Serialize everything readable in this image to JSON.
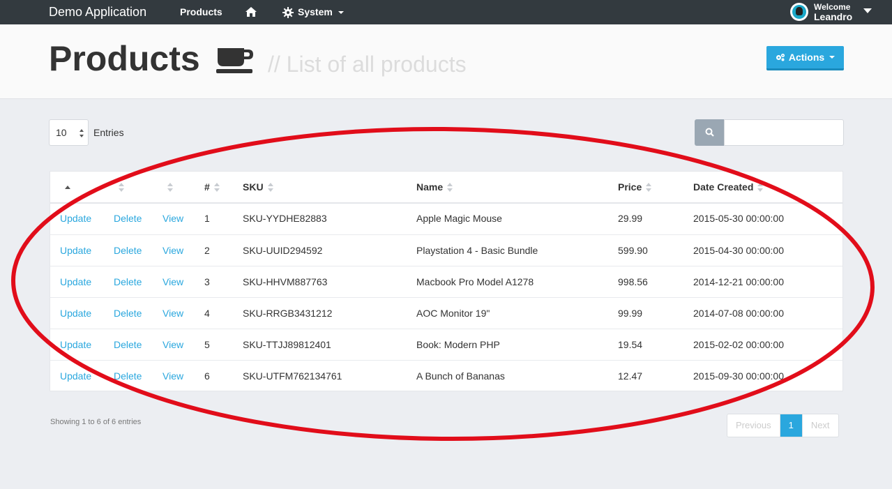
{
  "navbar": {
    "brand": "Demo Application",
    "products": "Products",
    "system": "System",
    "welcome": "Welcome",
    "username": "Leandro"
  },
  "header": {
    "title": "Products",
    "subtitle": "// List of all products",
    "actions_label": "Actions"
  },
  "toolbar": {
    "entries_value": "10",
    "entries_label": "Entries"
  },
  "table": {
    "columns": [
      "#",
      "SKU",
      "Name",
      "Price",
      "Date Created"
    ],
    "row_actions": [
      "Update",
      "Delete",
      "View"
    ],
    "rows": [
      {
        "id": "1",
        "sku": "SKU-YYDHE82883",
        "name": "Apple Magic Mouse",
        "price": "29.99",
        "date": "2015-05-30 00:00:00"
      },
      {
        "id": "2",
        "sku": "SKU-UUID294592",
        "name": "Playstation 4 - Basic Bundle",
        "price": "599.90",
        "date": "2015-04-30 00:00:00"
      },
      {
        "id": "3",
        "sku": "SKU-HHVM887763",
        "name": "Macbook Pro Model A1278",
        "price": "998.56",
        "date": "2014-12-21 00:00:00"
      },
      {
        "id": "4",
        "sku": "SKU-RRGB3431212",
        "name": "AOC Monitor 19\"",
        "price": "99.99",
        "date": "2014-07-08 00:00:00"
      },
      {
        "id": "5",
        "sku": "SKU-TTJJ89812401",
        "name": "Book: Modern PHP",
        "price": "19.54",
        "date": "2015-02-02 00:00:00"
      },
      {
        "id": "6",
        "sku": "SKU-UTFM762134761",
        "name": "A Bunch of Bananas",
        "price": "12.47",
        "date": "2015-09-30 00:00:00"
      }
    ]
  },
  "footer": {
    "showing": "Showing 1 to 6 of 6 entries",
    "previous": "Previous",
    "page": "1",
    "next": "Next"
  },
  "colors": {
    "navbar": "#333a3f",
    "accent": "#2aa7de",
    "annotation": "#e0000e"
  }
}
